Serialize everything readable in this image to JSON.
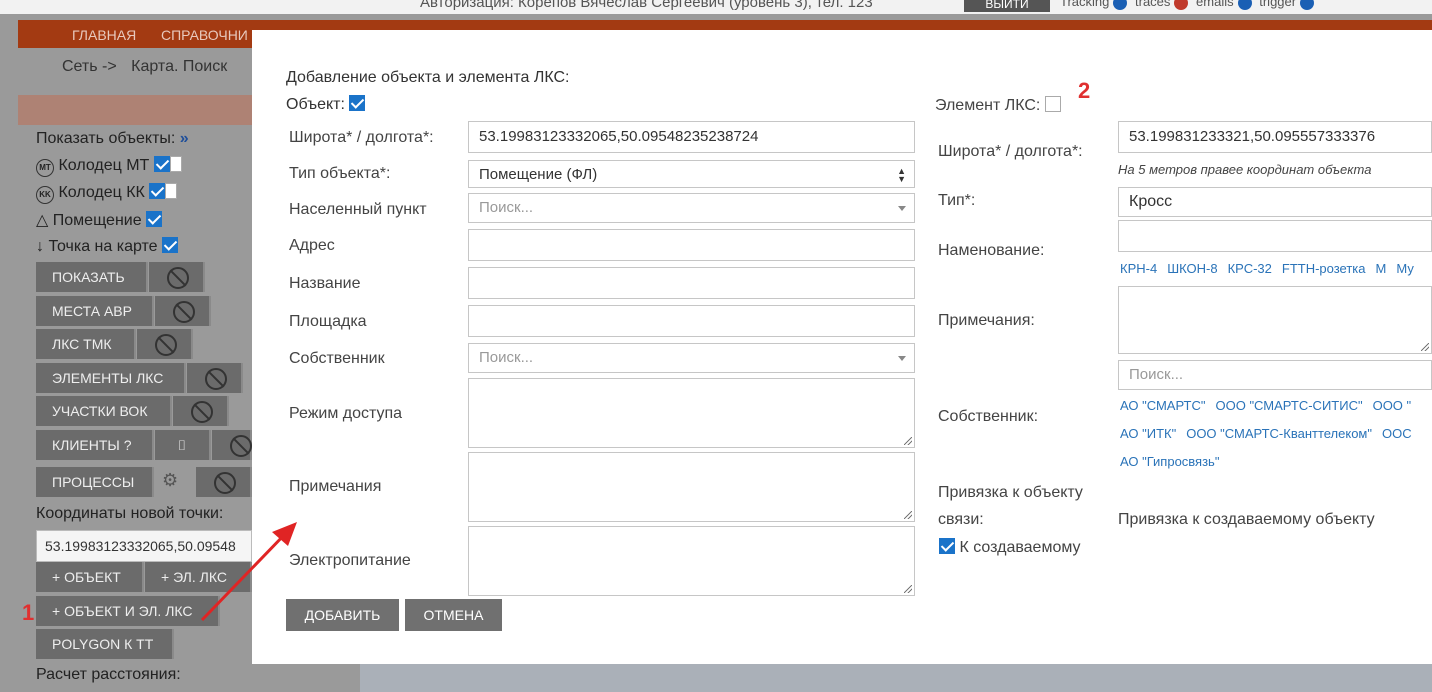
{
  "topbar": {
    "auth_text": "Авторизация: Корепов Вячеслав Сергеевич (уровень 3), тел. 123",
    "exit_label": "ВЫЙТИ",
    "badges": [
      {
        "label": "Tracking",
        "color": "#1a5fb4"
      },
      {
        "label": "traces",
        "color": "#c0392b"
      },
      {
        "label": "emails",
        "color": "#1a5fb4"
      },
      {
        "label": "trigger",
        "color": "#1a5fb4"
      }
    ]
  },
  "nav": {
    "items": [
      "ГЛАВНАЯ",
      "СПРАВОЧНИ"
    ]
  },
  "breadcrumb": {
    "network": "Сеть ->",
    "page": "Карта. Поиск"
  },
  "sidebar": {
    "show_objects_label": "Показать объекты:",
    "show_objects_chevron": "»",
    "layers": [
      {
        "icon": "MT",
        "label": "Колодец МТ",
        "checked": true
      },
      {
        "icon": "KK",
        "label": "Колодец КК",
        "checked": true
      },
      {
        "icon": "triangle",
        "label": "Помещение",
        "checked": true
      },
      {
        "icon": "arrow-down",
        "label": "Точка на карте",
        "checked": true
      }
    ],
    "buttons": [
      "ПОКАЗАТЬ",
      "МЕСТА АВР",
      "ЛКС ТМК",
      "ЭЛЕМЕНТЫ ЛКС",
      "УЧАСТКИ ВОК",
      "КЛИЕНТЫ ?",
      "ПРОЦЕССЫ"
    ],
    "new_point_label": "Координаты новой точки:",
    "new_point_value": "53.19983123332065,50.09548",
    "add_object": "+ ОБЪЕКТ",
    "add_element": "+ ЭЛ. ЛКС",
    "add_object_and_element": "+ ОБЪЕКТ И ЭЛ. ЛКС",
    "polygon_tt": "POLYGON К ТТ",
    "distance_label": "Расчет расстояния:"
  },
  "annotations": {
    "marker_1": "1",
    "marker_2": "2"
  },
  "modal": {
    "title": "Добавление объекта и элемента ЛКС:",
    "object_label": "Объект:",
    "object_checked": true,
    "left": {
      "latlon_label": "Широта* / долгота*:",
      "latlon_value": "53.19983123332065,50.09548235238724",
      "type_label": "Тип объекта*:",
      "type_value": "Помещение (ФЛ)",
      "locality_label": "Населенный пункт",
      "locality_placeholder": "Поиск...",
      "address_label": "Адрес",
      "address_value": "",
      "name_label": "Название",
      "name_value": "",
      "site_label": "Площадка",
      "site_value": "",
      "owner_label": "Собственник",
      "owner_placeholder": "Поиск...",
      "access_label": "Режим доступа",
      "notes_label": "Примечания",
      "power_label": "Электропитание"
    },
    "add_button": "ДОБАВИТЬ",
    "cancel_button": "ОТМЕНА",
    "right": {
      "element_label": "Элемент ЛКС:",
      "element_checked": false,
      "latlon_label": "Широта* / долгота*:",
      "latlon_value": "53.199831233321,50.095557333376",
      "latlon_hint": "На 5 метров правее координат объекта",
      "type_label": "Тип*:",
      "type_value": "Кросс",
      "name_label": "Наменование:",
      "name_value": "",
      "name_tags": [
        "КРН-4",
        "ШКОН-8",
        "КРС-32",
        "FTTH-розетка",
        "М",
        "Му"
      ],
      "notes_label": "Примечания:",
      "owner_label": "Собственник:",
      "owner_placeholder": "Поиск...",
      "owner_tags_row1": [
        "АО \"СМАРТС\"",
        "ООО \"СМАРТС-СИТИС\"",
        "ООО \""
      ],
      "owner_tags_row2": [
        "АО \"ИТК\"",
        "ООО \"СМАРТС-Кванттелеком\"",
        "ООС"
      ],
      "owner_tags_row3": [
        "АО \"Гипросвязь\""
      ],
      "binding_label_1": "Привязка к объекту",
      "binding_label_2": "связи:",
      "binding_value": "Привязка к создаваемому объекту",
      "to_created_label": "К создаваемому",
      "to_created_checked": true
    }
  }
}
